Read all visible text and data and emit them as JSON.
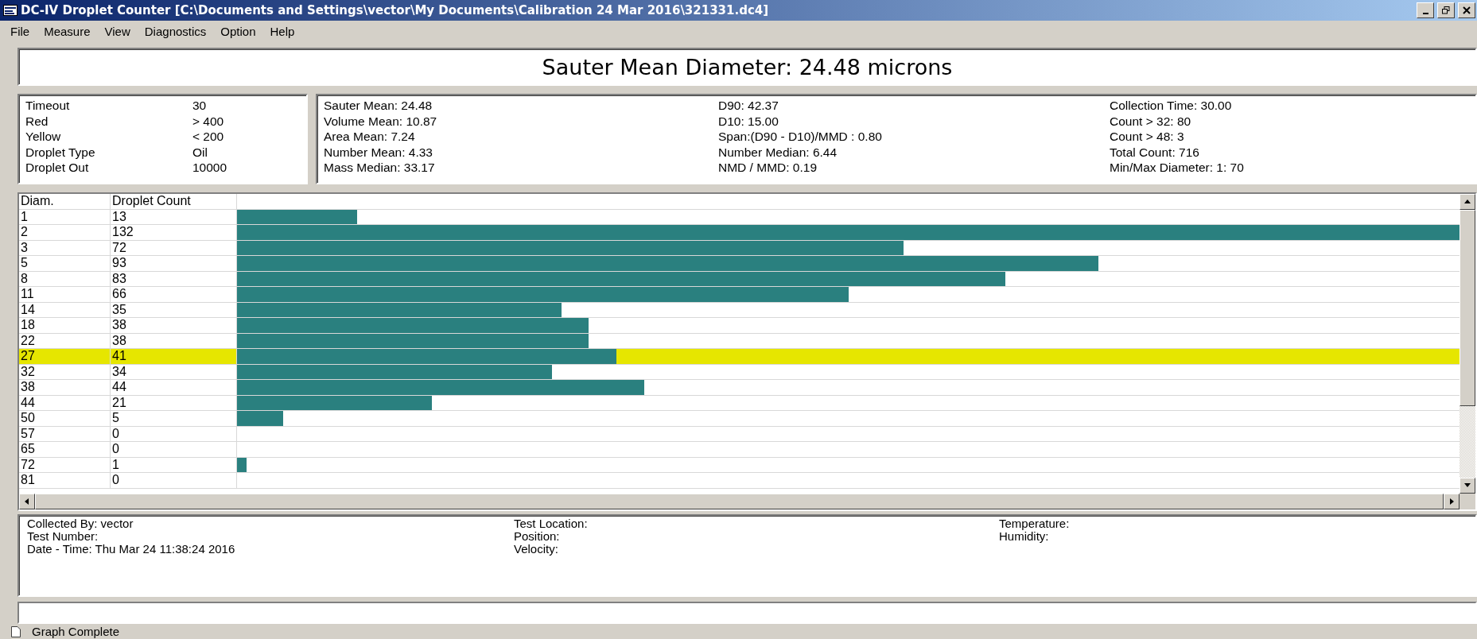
{
  "window": {
    "title": "DC-IV Droplet Counter [C:\\Documents and Settings\\vector\\My Documents\\Calibration 24 Mar 2016\\321331.dc4]"
  },
  "menu": [
    "File",
    "Measure",
    "View",
    "Diagnostics",
    "Option",
    "Help"
  ],
  "headline": "Sauter Mean Diameter: 24.48 microns",
  "settings": [
    {
      "label": "Timeout",
      "value": "30"
    },
    {
      "label": "Red",
      "value": "> 400"
    },
    {
      "label": "Yellow",
      "value": "< 200"
    },
    {
      "label": "Droplet Type",
      "value": "Oil"
    },
    {
      "label": "Droplet Out",
      "value": "10000"
    }
  ],
  "statistics": [
    [
      "Sauter Mean: 24.48",
      "Volume Mean: 10.87",
      "Area Mean: 7.24",
      "Number Mean: 4.33",
      "Mass Median: 33.17"
    ],
    [
      "D90: 42.37",
      "D10: 15.00",
      "Span:(D90 - D10)/MMD : 0.80",
      "Number Median: 6.44",
      "NMD / MMD: 0.19"
    ],
    [
      "Collection Time: 30.00",
      "Count > 32: 80",
      "Count > 48: 3",
      "Total Count: 716",
      "Min/Max Diameter: 1: 70"
    ]
  ],
  "table": {
    "columns": [
      "Diam.",
      "Droplet Count"
    ],
    "rows": [
      {
        "diam": "1",
        "count": "13",
        "selected": false
      },
      {
        "diam": "2",
        "count": "132",
        "selected": false
      },
      {
        "diam": "3",
        "count": "72",
        "selected": false
      },
      {
        "diam": "5",
        "count": "93",
        "selected": false
      },
      {
        "diam": "8",
        "count": "83",
        "selected": false
      },
      {
        "diam": "11",
        "count": "66",
        "selected": false
      },
      {
        "diam": "14",
        "count": "35",
        "selected": false
      },
      {
        "diam": "18",
        "count": "38",
        "selected": false
      },
      {
        "diam": "22",
        "count": "38",
        "selected": false
      },
      {
        "diam": "27",
        "count": "41",
        "selected": true
      },
      {
        "diam": "32",
        "count": "34",
        "selected": false
      },
      {
        "diam": "38",
        "count": "44",
        "selected": false
      },
      {
        "diam": "44",
        "count": "21",
        "selected": false
      },
      {
        "diam": "50",
        "count": "5",
        "selected": false
      },
      {
        "diam": "57",
        "count": "0",
        "selected": false
      },
      {
        "diam": "65",
        "count": "0",
        "selected": false
      },
      {
        "diam": "72",
        "count": "1",
        "selected": false
      },
      {
        "diam": "81",
        "count": "0",
        "selected": false
      }
    ]
  },
  "details": [
    [
      "Collected By: vector",
      "Test Number:",
      "Date - Time: Thu Mar 24 11:38:24 2016"
    ],
    [
      "Test Location:",
      "Position:",
      "Velocity:"
    ],
    [
      "Temperature:",
      "Humidity:"
    ]
  ],
  "status_bar": "Graph Complete"
}
